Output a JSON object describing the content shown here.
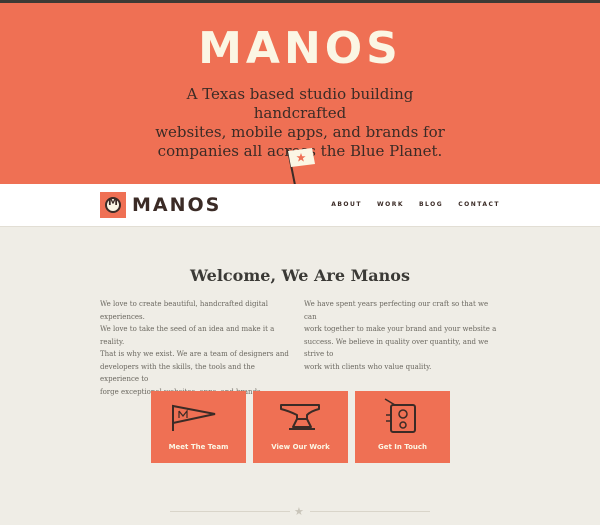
{
  "hero": {
    "logo": "MANOS",
    "tagline_lines": [
      "A Texas based studio building handcrafted",
      "websites, mobile apps, and brands for",
      "companies all across the Blue Planet."
    ],
    "flag_icon": "flag-star-icon"
  },
  "nav": {
    "logo_letter": "M",
    "logo_text": "MANOS",
    "links": [
      "ABOUT",
      "WORK",
      "BLOG",
      "CONTACT"
    ]
  },
  "welcome": {
    "title": "Welcome, We Are Manos",
    "left_lines": [
      "We love to create beautiful, handcrafted digital experiences.",
      "We love to take the seed of an idea and make it a reality.",
      "That is why we exist. We are a team of designers and",
      "developers with the skills, the tools and the experience to",
      "forge exceptional websites, apps, and brands."
    ],
    "right_lines": [
      "We have spent years perfecting our craft so that we can",
      "work together to make your brand and your website a",
      "success. We believe in quality over quantity, and we strive to",
      "work with clients who value quality."
    ]
  },
  "tiles": [
    {
      "label": "Meet The Team",
      "icon": "pennant-icon"
    },
    {
      "label": "View Our Work",
      "icon": "anvil-icon"
    },
    {
      "label": "Get In Touch",
      "icon": "radio-icon"
    }
  ],
  "colors": {
    "accent": "#ef7054",
    "cream": "#fbf6e4",
    "dark": "#3b2b26",
    "background": "#efede6"
  }
}
